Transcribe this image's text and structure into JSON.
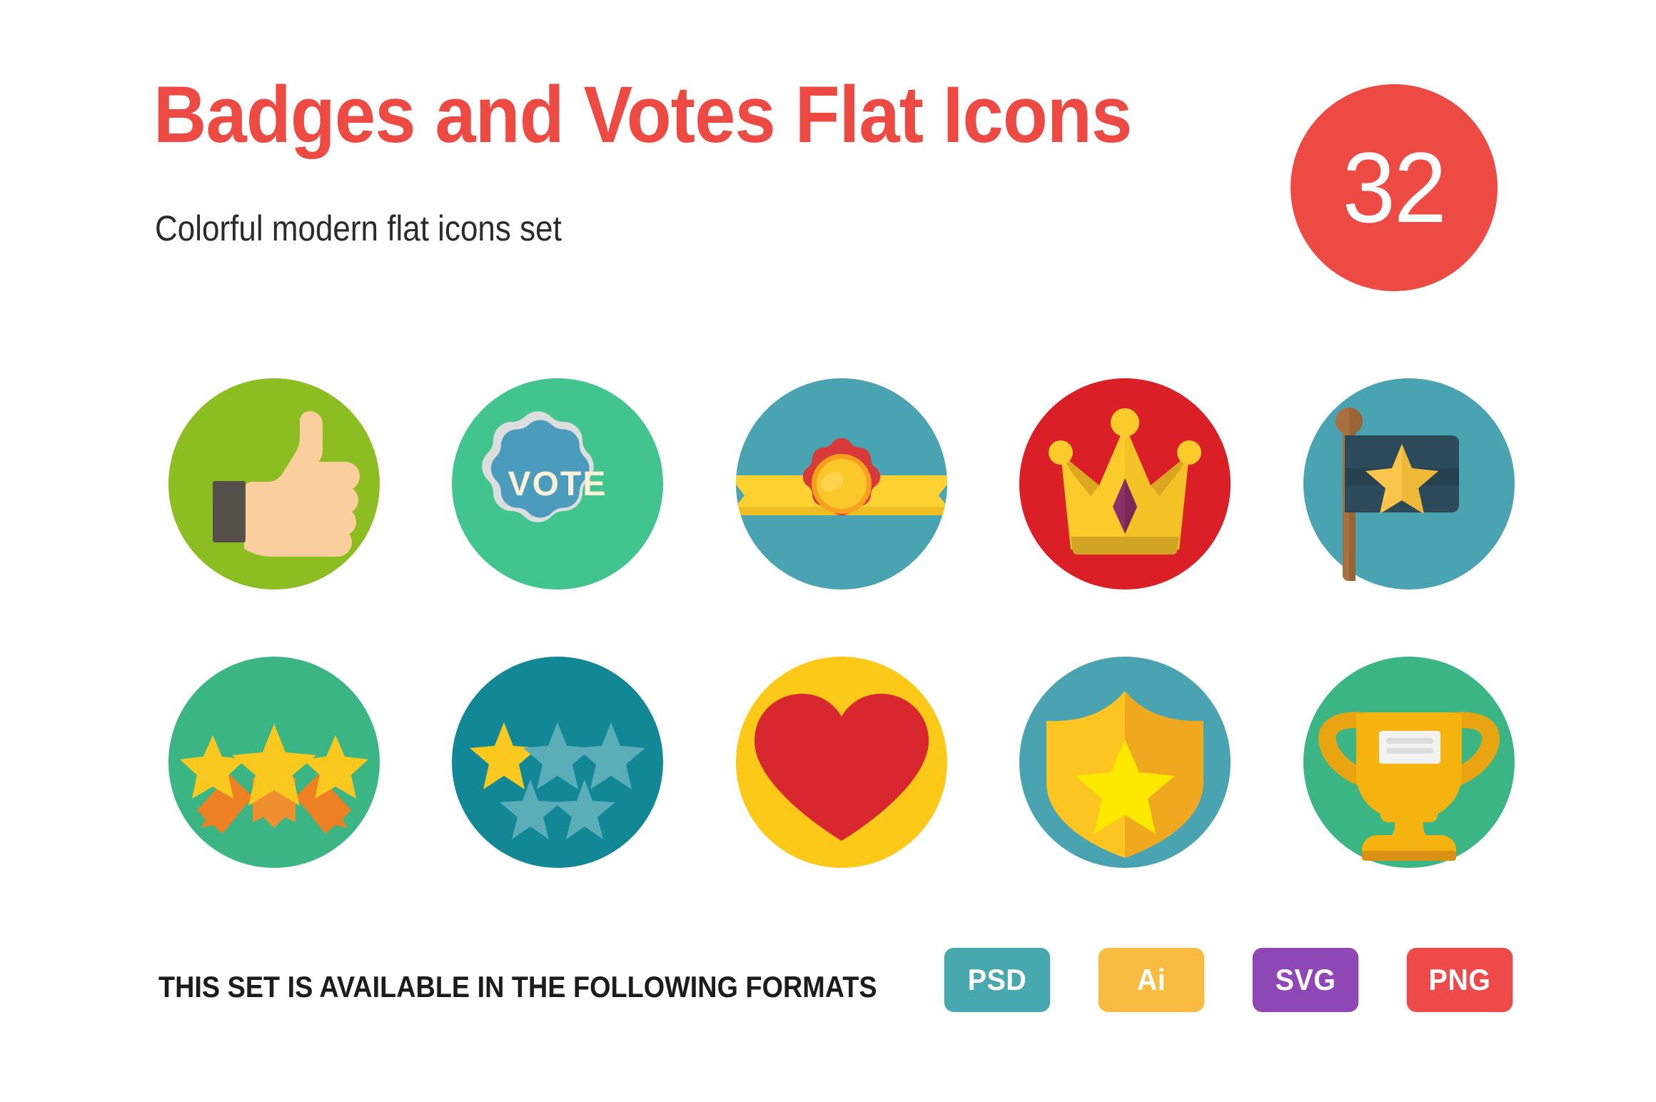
{
  "header": {
    "title": "Badges and Votes Flat Icons",
    "subtitle": "Colorful modern flat icons  set",
    "count": "32",
    "title_color": "#EE4A44",
    "badge_color": "#EE4A44",
    "subtitle_color": "#2B2B2B"
  },
  "icons": [
    {
      "name": "thumbs-up",
      "label": "Thumbs up",
      "circle_color": "#8CBE22",
      "colors": {
        "hand": "#FBCE9D",
        "cuff": "#56504A"
      }
    },
    {
      "name": "vote-badge",
      "label": "Vote badge",
      "text": "VOTE",
      "circle_color": "#41C48E",
      "colors": {
        "badge": "#4B9CBC",
        "border": "#DCDDDD",
        "text": "#FBF0D8"
      }
    },
    {
      "name": "rosette-ribbon",
      "label": "Award rosette with ribbon",
      "circle_color": "#4AA3B0",
      "colors": {
        "ribbon": "#FDD131",
        "ribbon_shadow": "#EFBE24",
        "flower": "#D83A3A",
        "ring": "#F6A01E",
        "center": "#FBC82C"
      }
    },
    {
      "name": "crown",
      "label": "Crown",
      "circle_color": "#DA1F26",
      "colors": {
        "gold": "#FBCB2B",
        "gold_shade": "#EFB820",
        "gem": "#8E3068",
        "base": "#D2A423"
      }
    },
    {
      "name": "star-flag",
      "label": "Flag with star",
      "circle_color": "#4AA3B0",
      "colors": {
        "flag": "#2C4A5A",
        "flag_shade": "#264150",
        "pole": "#A9703F",
        "star": "#F9C54A"
      }
    },
    {
      "name": "three-shooting-stars",
      "label": "Three shooting stars",
      "circle_color": "#3CB585",
      "colors": {
        "star": "#FBC820",
        "trail": "#ED8022"
      }
    },
    {
      "name": "star-rating",
      "label": "Star rating one of five",
      "circle_color": "#128896",
      "colors": {
        "star_active": "#FBC820",
        "star_inactive": "#5BADB8"
      },
      "rating": 1,
      "total": 5
    },
    {
      "name": "heart",
      "label": "Heart",
      "circle_color": "#FCC918",
      "colors": {
        "heart": "#D92730"
      }
    },
    {
      "name": "star-shield",
      "label": "Shield with star",
      "circle_color": "#4AA3B0",
      "colors": {
        "shield_light": "#FCC522",
        "shield_dark": "#F0A81E",
        "star": "#FDE800"
      }
    },
    {
      "name": "trophy",
      "label": "Trophy cup",
      "circle_color": "#3CB585",
      "colors": {
        "cup": "#F5B310",
        "handle": "#E9A412",
        "base_shade": "#D99214",
        "plaque": "#F2F2F2"
      }
    }
  ],
  "footer": {
    "formats_label": "THIS SET IS AVAILABLE IN THE FOLLOWING FORMATS",
    "badges": [
      {
        "label": "PSD",
        "color": "#48A8B0"
      },
      {
        "label": "Ai",
        "color": "#F9BC41"
      },
      {
        "label": "SVG",
        "color": "#9047B6"
      },
      {
        "label": "PNG",
        "color": "#EE4A4A"
      }
    ]
  }
}
